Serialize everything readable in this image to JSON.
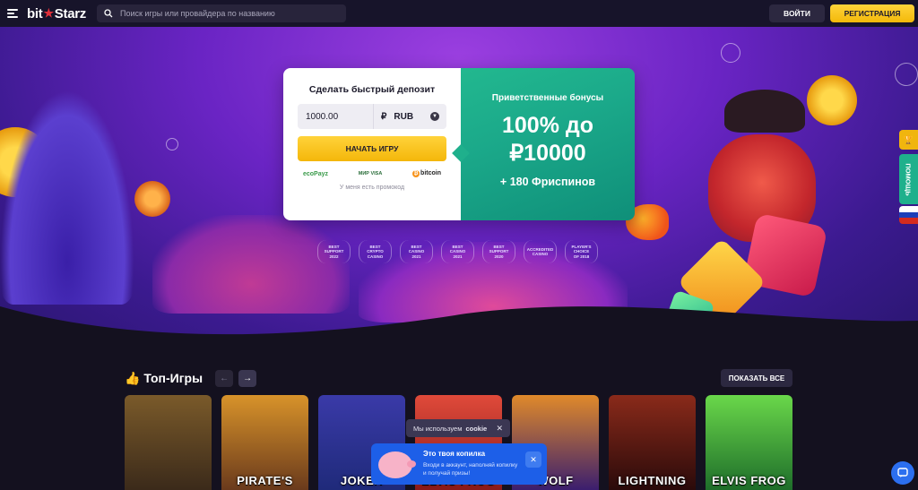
{
  "header": {
    "logo_left": "bit",
    "logo_right": "Starz",
    "search_placeholder": "Поиск игры или провайдера по названию",
    "login_label": "ВОЙТИ",
    "register_label": "РЕГИСТРАЦИЯ"
  },
  "deposit": {
    "title": "Сделать быстрый депозит",
    "amount": "1000.00",
    "currency_sign": "₽",
    "currency": "RUB",
    "start_label": "НАЧАТЬ ИГРУ",
    "payments": [
      "ecoPayz",
      "МИР VISA",
      "bitcoin"
    ],
    "promo_link": "У меня есть промокод"
  },
  "bonus": {
    "subtitle": "Приветственные бонусы",
    "line1": "100% до",
    "line2": "₽10000",
    "freespins": "+ 180 Фриспинов"
  },
  "awards": [
    {
      "l1": "BEST",
      "l2": "SUPPORT",
      "l3": "2022"
    },
    {
      "l1": "BEST",
      "l2": "CRYPTO",
      "l3": "CASINO"
    },
    {
      "l1": "BEST",
      "l2": "CASINO",
      "l3": "2021"
    },
    {
      "l1": "BEST",
      "l2": "CASINO",
      "l3": "2021"
    },
    {
      "l1": "BEST",
      "l2": "SUPPORT",
      "l3": "2020"
    },
    {
      "l1": "ACCREDITED",
      "l2": "CASINO",
      "l3": ""
    },
    {
      "l1": "PLAYER'S",
      "l2": "CHOICE",
      "l3": "OF 2018"
    }
  ],
  "side": {
    "help_label": "ПОМОЩЬ"
  },
  "games": {
    "title": "👍 Топ-Игры",
    "prev": "←",
    "next": "→",
    "show_all": "ПОКАЗАТЬ ВСЕ",
    "items": [
      {
        "name": "",
        "bg": "#3b2a1a"
      },
      {
        "name": "PIRATE'S",
        "bg": "#6a3a1c"
      },
      {
        "name": "JOKER",
        "bg": "#1f2a7a"
      },
      {
        "name": "ELVIS FROG",
        "bg": "#c0392b"
      },
      {
        "name": "WOLF",
        "bg": "#3b1e6e"
      },
      {
        "name": "LIGHTNING",
        "bg": "#5a1414"
      },
      {
        "name": "ELVIS FROG",
        "bg": "#1e6e2a"
      }
    ]
  },
  "cookie": {
    "text": "Мы используем",
    "link": "cookie",
    "close": "✕"
  },
  "piggy": {
    "title": "Это твоя копилка",
    "text": "Входи в аккаунт, наполняй копилку и получай призы!",
    "close": "✕"
  }
}
